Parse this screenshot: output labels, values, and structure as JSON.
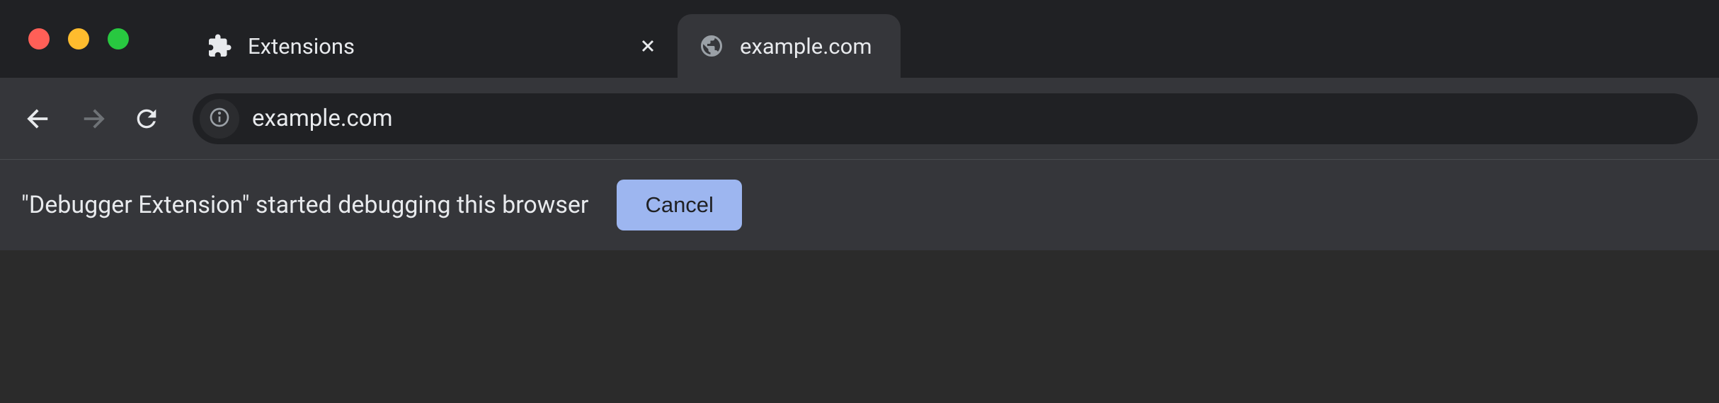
{
  "tabs": [
    {
      "title": "Extensions",
      "icon": "puzzle"
    },
    {
      "title": "example.com",
      "icon": "globe"
    }
  ],
  "address_bar": {
    "url": "example.com"
  },
  "infobar": {
    "message": "\"Debugger Extension\" started debugging this browser",
    "cancel_label": "Cancel"
  }
}
